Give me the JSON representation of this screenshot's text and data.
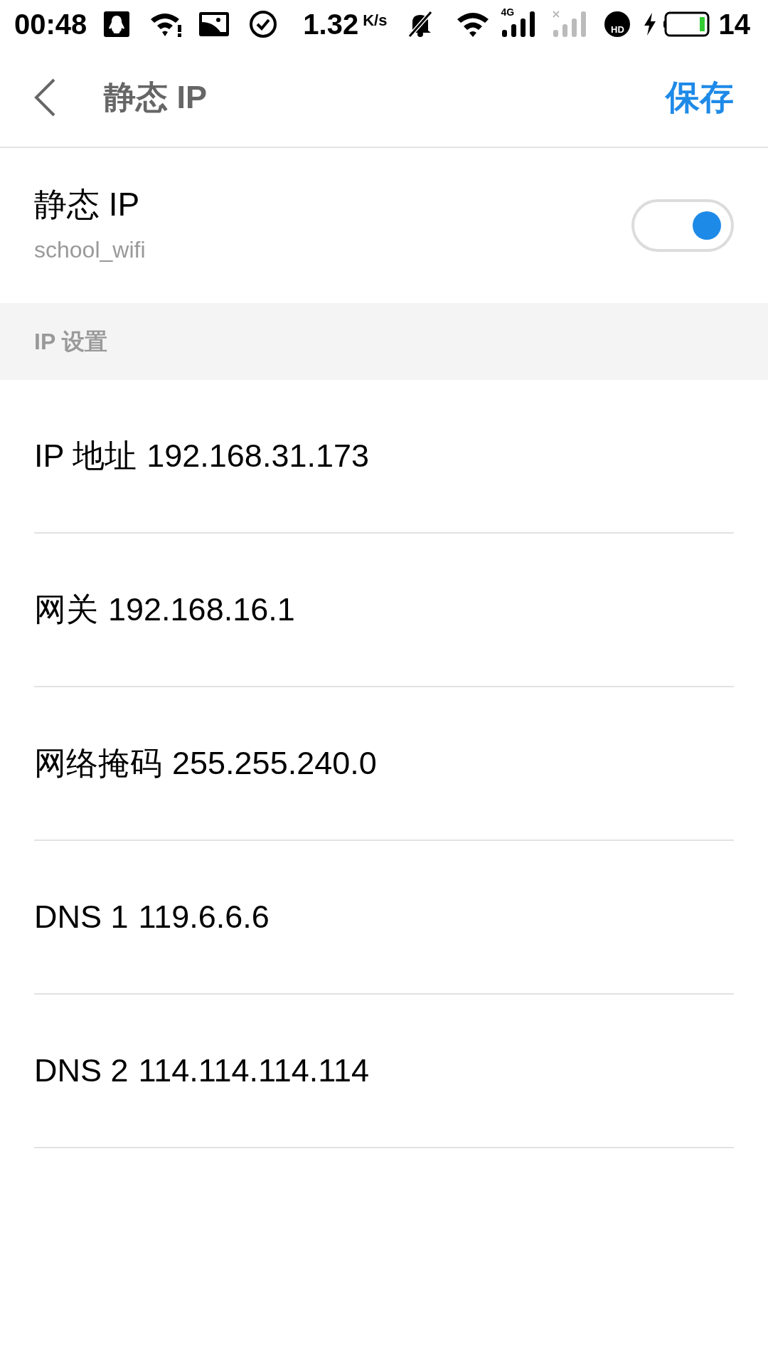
{
  "status_bar": {
    "time": "00:48",
    "speed": "1.32",
    "speed_unit": "K/s",
    "network_label": "4G",
    "call_label": "HD",
    "battery": "14"
  },
  "header": {
    "title": "静态 IP",
    "action": "保存"
  },
  "toggle_row": {
    "title": "静态 IP",
    "subtitle": "school_wifi",
    "on": true
  },
  "section": {
    "title": "IP 设置"
  },
  "fields": [
    {
      "label": "IP 地址",
      "value": "192.168.31.173"
    },
    {
      "label": "网关",
      "value": "192.168.16.1"
    },
    {
      "label": "网络掩码",
      "value": "255.255.240.0"
    },
    {
      "label": "DNS 1",
      "value": "119.6.6.6"
    },
    {
      "label": "DNS 2",
      "value": "114.114.114.114"
    }
  ]
}
